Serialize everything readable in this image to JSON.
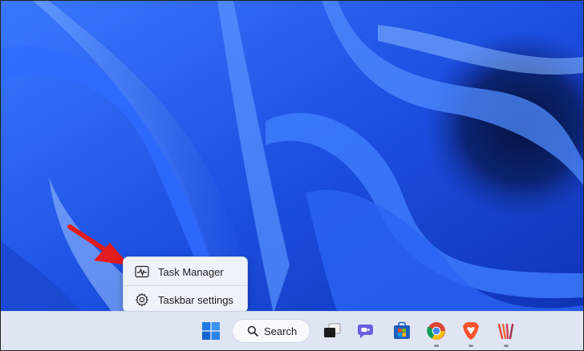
{
  "context_menu": {
    "items": [
      {
        "label": "Task Manager",
        "icon": "task-manager-icon"
      },
      {
        "label": "Taskbar settings",
        "icon": "gear-icon"
      }
    ]
  },
  "taskbar": {
    "search_label": "Search",
    "apps": [
      {
        "name": "start-button",
        "icon": "windows-logo-icon"
      },
      {
        "name": "task-view-button",
        "icon": "task-view-icon"
      },
      {
        "name": "teams-chat-button",
        "icon": "teams-chat-icon"
      },
      {
        "name": "microsoft-store-button",
        "icon": "store-icon"
      },
      {
        "name": "chrome-button",
        "icon": "chrome-icon"
      },
      {
        "name": "brave-button",
        "icon": "brave-icon"
      },
      {
        "name": "app-button",
        "icon": "stripes-app-icon"
      }
    ]
  },
  "colors": {
    "wallpaper_primary": "#1b4fd6",
    "wallpaper_dark": "#0a1f6e",
    "annotation_arrow": "#e21b1b"
  }
}
